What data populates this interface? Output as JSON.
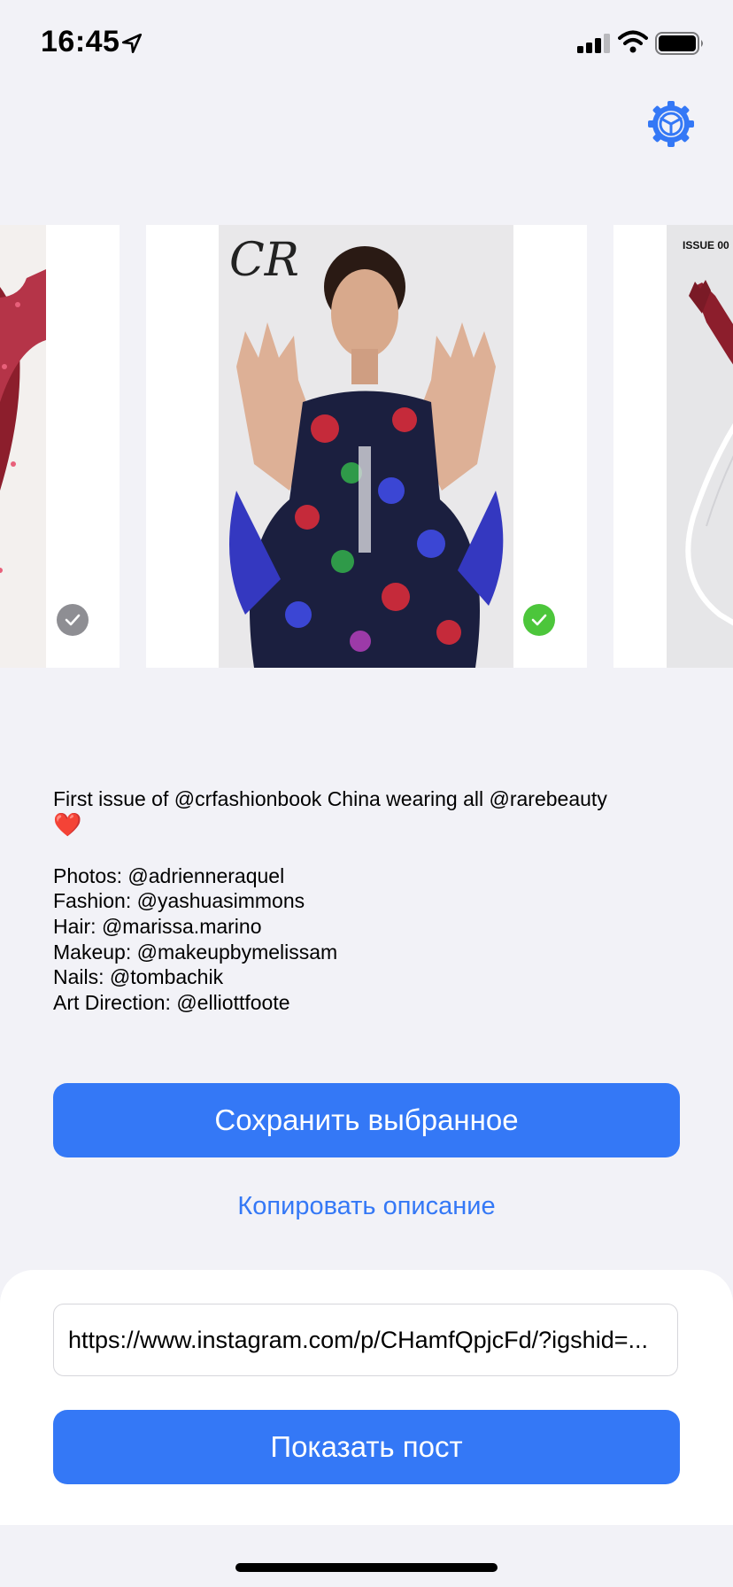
{
  "status_bar": {
    "time": "16:45",
    "location_icon": "location-arrow-icon",
    "signal_icon": "cellular-signal-icon",
    "wifi_icon": "wifi-icon",
    "battery_icon": "battery-icon"
  },
  "header": {
    "settings_icon": "gear-icon",
    "accent_color": "#3478f6"
  },
  "carousel": {
    "items": [
      {
        "name": "photo-left",
        "selected": false
      },
      {
        "name": "photo-center",
        "selected": true,
        "logo_text": "CR"
      },
      {
        "name": "photo-right",
        "selected": false,
        "cover_text": "ISSUE 00"
      }
    ]
  },
  "caption": {
    "line1": "First issue of @crfashionbook China wearing all @rarebeauty",
    "heart": "❤️",
    "credits": "Photos: @adrienneraquel\nFashion: @yashuasimmons\nHair: @marissa.marino\nMakeup: @makeupbymelissam\nNails: @tombachik\nArt Direction: @elliottfoote"
  },
  "actions": {
    "save_label": "Сохранить выбранное",
    "copy_label": "Копировать описание"
  },
  "bottom": {
    "url_value": "https://www.instagram.com/p/CHamfQpjcFd/?igshid=...",
    "show_label": "Показать пост"
  },
  "colors": {
    "check_on": "#4cc63b",
    "check_off": "#8e8e93",
    "background": "#f2f2f7"
  }
}
